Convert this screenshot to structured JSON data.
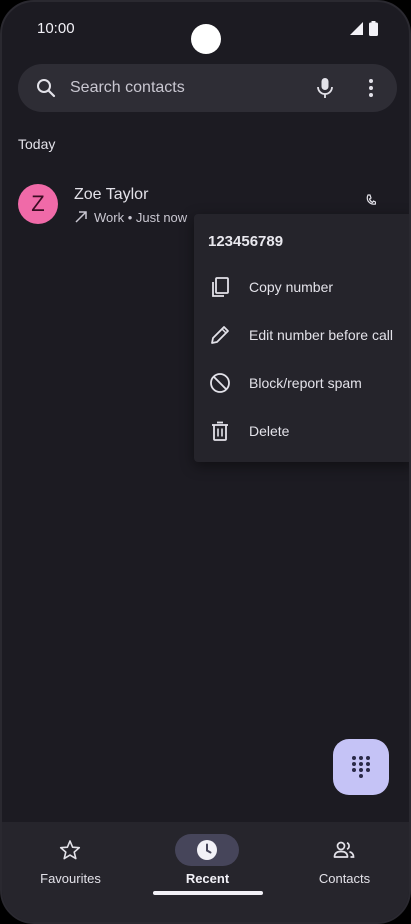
{
  "status_bar": {
    "time": "10:00"
  },
  "search": {
    "placeholder": "Search contacts"
  },
  "recent": {
    "section_label": "Today",
    "calls": [
      {
        "avatar_letter": "Z",
        "avatar_color": "#f06aa8",
        "name": "Zoe Taylor",
        "meta": "Work • Just now",
        "direction_icon": "outgoing-arrow-icon"
      }
    ]
  },
  "context_menu": {
    "number": "123456789",
    "items": [
      {
        "label": "Copy number",
        "icon": "copy-icon"
      },
      {
        "label": "Edit number before call",
        "icon": "pencil-icon"
      },
      {
        "label": "Block/report spam",
        "icon": "block-icon"
      },
      {
        "label": "Delete",
        "icon": "trash-icon"
      }
    ]
  },
  "fab": {
    "icon": "dialpad-icon",
    "color": "#c5c3f6"
  },
  "bottom_nav": {
    "items": [
      {
        "label": "Favourites",
        "icon": "star-icon",
        "active": false
      },
      {
        "label": "Recent",
        "icon": "clock-icon",
        "active": true
      },
      {
        "label": "Contacts",
        "icon": "people-icon",
        "active": false
      }
    ]
  },
  "colors": {
    "background": "#1c1b22",
    "surface": "#2e2d35",
    "menu": "#25242b",
    "accent": "#c5c3f6"
  }
}
